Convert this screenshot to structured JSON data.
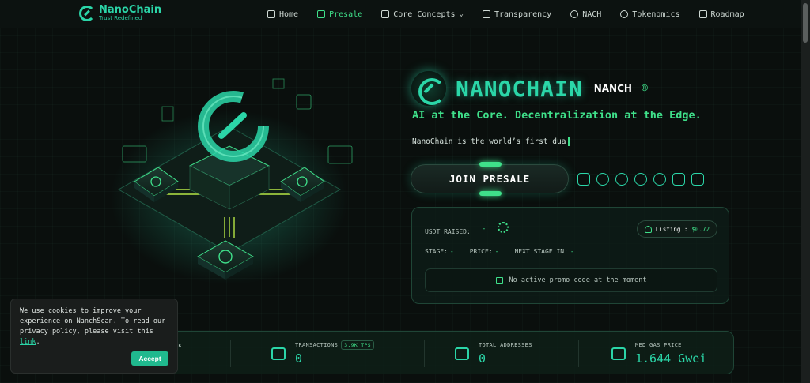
{
  "brand": {
    "name": "NanoChain",
    "tagline": "Trust Redefined"
  },
  "nav": {
    "items": [
      {
        "label": "Home",
        "icon": "home-icon"
      },
      {
        "label": "Presale",
        "icon": "lightning-icon",
        "active": true
      },
      {
        "label": "Core Concepts",
        "icon": "layers-icon",
        "dropdown": true
      },
      {
        "label": "Transparency",
        "icon": "shield-icon"
      },
      {
        "label": "NACH",
        "icon": "nach-logo-icon"
      },
      {
        "label": "Tokenomics",
        "icon": "coins-icon"
      },
      {
        "label": "Roadmap",
        "icon": "map-icon"
      }
    ]
  },
  "hero": {
    "title": "NANOCHAIN",
    "ticker": "NANCH",
    "reg": "®",
    "tagline": "AI at the Core. Decentralization at the Edge.",
    "typing": "NanoChain is the world’s first dua"
  },
  "presale": {
    "join_label": "JOIN PRESALE",
    "usdt_label": "USDT RAISED:",
    "usdt_value": "-",
    "listing_label": "Listing :",
    "listing_price": "$0.72",
    "stage_label": "STAGE:",
    "stage_value": "-",
    "price_label": "PRICE:",
    "price_value": "-",
    "next_stage_label": "NEXT STAGE IN:",
    "next_stage_value": "-",
    "promo_text": "No active promo code at the moment"
  },
  "socials": [
    "shield-social-icon",
    "coin-social-icon",
    "fox-social-icon",
    "chart-social-icon",
    "globe-social-icon",
    "robot-social-icon",
    "edit-social-icon"
  ],
  "stats": {
    "partial_label": "CK",
    "transactions_label": "TRANSACTIONS",
    "tps_badge": "3.9K TPS",
    "transactions_value": "0",
    "addresses_label": "TOTAL ADDRESSES",
    "addresses_value": "0",
    "gas_label": "MED GAS PRICE",
    "gas_value": "1.644 Gwei"
  },
  "cookie": {
    "text": "We use cookies to improve your experience on NanchScan. To read our privacy policy, please visit this ",
    "link": "link",
    "suffix": ".",
    "accept": "Accept"
  },
  "colors": {
    "accent": "#2bd6a8",
    "green": "#3fe08a",
    "bg": "#0a0f0d"
  }
}
